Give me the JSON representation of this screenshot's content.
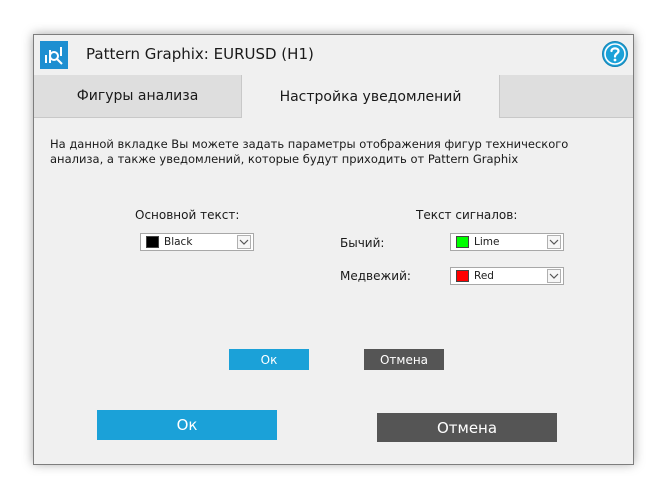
{
  "window": {
    "title": "Pattern Graphix: EURUSD (H1)",
    "help_icon": "question-circle-icon",
    "app_icon": "chart-magnifier-icon"
  },
  "tabs": [
    {
      "label": "Фигуры анализа",
      "active": false
    },
    {
      "label": "Настройка уведомлений",
      "active": true
    }
  ],
  "description": "На данной вкладке Вы можете задать параметры отображения фигур технического анализа, а также уведомлений, которые будут приходить от Pattern Graphix",
  "main_text": {
    "label": "Основной текст:",
    "color": {
      "value": "Black",
      "swatch": "#000000"
    }
  },
  "signal_text": {
    "label": "Текст сигналов:",
    "bullish": {
      "label": "Бычий:",
      "value": "Lime",
      "swatch": "#00ff00"
    },
    "bearish": {
      "label": "Медвежий:",
      "value": "Red",
      "swatch": "#ff0000"
    }
  },
  "inner_buttons": {
    "ok": "Ок",
    "cancel": "Отмена"
  },
  "outer_buttons": {
    "ok": "Ок",
    "cancel": "Отмена"
  },
  "colors": {
    "accent": "#1ba1d8",
    "cancel": "#555555"
  }
}
